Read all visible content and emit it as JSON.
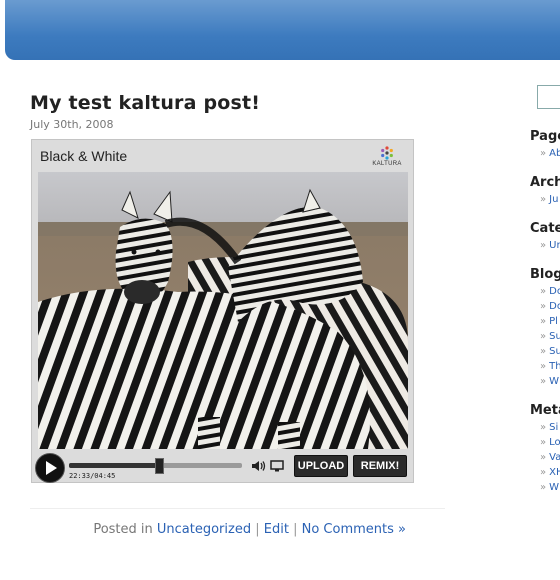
{
  "post": {
    "title": "My test kaltura post!",
    "date": "July 30th, 2008"
  },
  "player": {
    "title": "Black & White",
    "logo_text": "KALTURA",
    "timecode": "22:33/04:45",
    "progress_fraction": 0.52,
    "upload_label": "UPLOAD",
    "remix_label": "REMIX!",
    "icons": [
      "play-icon",
      "volume-icon",
      "fullscreen-icon"
    ]
  },
  "meta": {
    "posted_in": "Posted in",
    "category": "Uncategorized",
    "sep1": "|",
    "edit": "Edit",
    "sep2": "|",
    "comments": "No Comments »"
  },
  "sidebar": {
    "sections": [
      {
        "title": "Page",
        "items": [
          "Ab"
        ]
      },
      {
        "title": "Arch",
        "items": [
          "Ju"
        ]
      },
      {
        "title": "Cate",
        "items": [
          "Ur"
        ]
      },
      {
        "title": "Blog",
        "items": [
          "Do",
          "Do",
          "Pl",
          "Su",
          "Su",
          "Th",
          "W"
        ]
      },
      {
        "title": "Meta",
        "items": [
          "Si",
          "Lo",
          "Va",
          "XH",
          "W"
        ]
      }
    ]
  },
  "colors": {
    "header": "#3d7bbf",
    "link": "#2b62b4"
  }
}
